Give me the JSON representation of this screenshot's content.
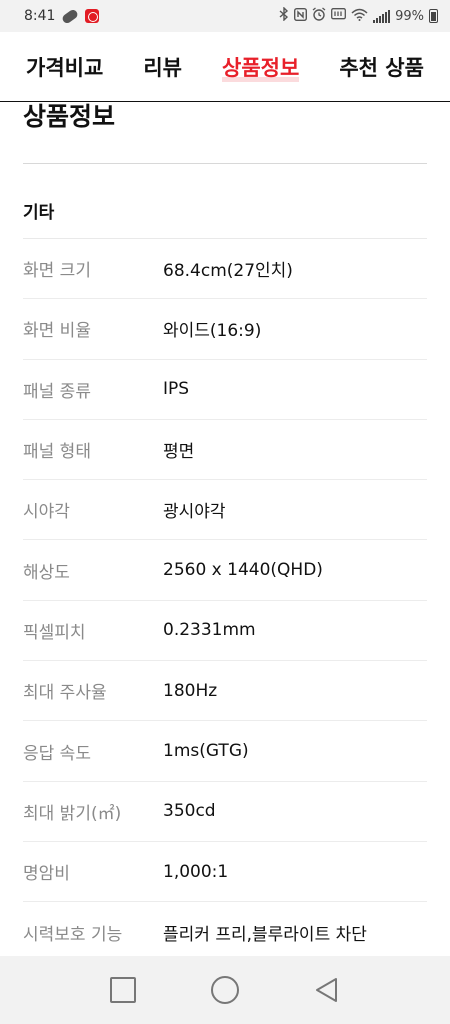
{
  "status_bar": {
    "time": "8:41",
    "battery_text": "99%"
  },
  "tabs": [
    {
      "label": "가격비교",
      "active": false
    },
    {
      "label": "리뷰",
      "active": false
    },
    {
      "label": "상품정보",
      "active": true
    },
    {
      "label": "추천 상품",
      "active": false
    }
  ],
  "section": {
    "title": "상품정보",
    "group_title": "기타",
    "specs": [
      {
        "label": "화면 크기",
        "value": "68.4cm(27인치)"
      },
      {
        "label": "화면 비율",
        "value": "와이드(16:9)"
      },
      {
        "label": "패널 종류",
        "value": "IPS"
      },
      {
        "label": "패널 형태",
        "value": "평면"
      },
      {
        "label": "시야각",
        "value": "광시야각"
      },
      {
        "label": "해상도",
        "value": "2560 x 1440(QHD)"
      },
      {
        "label": "픽셀피치",
        "value": "0.2331mm"
      },
      {
        "label": "최대 주사율",
        "value": "180Hz"
      },
      {
        "label": "응답 속도",
        "value": "1ms(GTG)"
      },
      {
        "label": "최대 밝기(㎡)",
        "value": "350cd"
      },
      {
        "label": "명암비",
        "value": "1,000:1"
      },
      {
        "label": "시력보호 기능",
        "value": "플리커 프리,블루라이트 차단"
      }
    ]
  },
  "colors": {
    "accent": "#e8202a",
    "label_gray": "#8a8a8a"
  },
  "icons": {
    "status": [
      "pill-icon",
      "app-notification-icon",
      "bluetooth-icon",
      "nfc-icon",
      "alarm-icon",
      "lte-icon",
      "wifi-icon",
      "signal-icon",
      "battery-icon"
    ],
    "nav": [
      "recent-apps-icon",
      "home-icon",
      "back-icon"
    ]
  }
}
